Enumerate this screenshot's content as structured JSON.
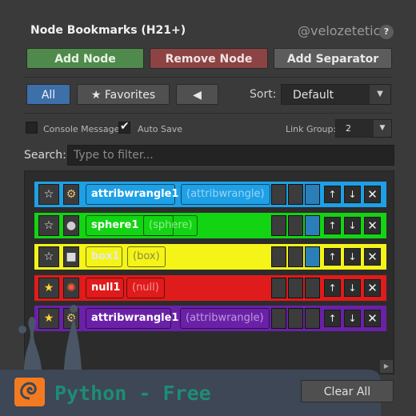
{
  "header": {
    "title": "Node Bookmarks (H21+)",
    "handle": "@velozetetic",
    "help": "?"
  },
  "toolbar": {
    "add": "Add Node",
    "remove": "Remove Node",
    "separator": "Add Separator"
  },
  "filters": {
    "all": "All",
    "favorites": "★ Favorites",
    "back": "◀",
    "sort_label": "Sort:",
    "sort_value": "Default"
  },
  "options": {
    "console": "Console Messages",
    "autosave": "Auto Save",
    "autosave_checked": true,
    "console_checked": false,
    "link_group_label": "Link Group:",
    "link_group_value": "2"
  },
  "search": {
    "label": "Search:",
    "placeholder": "Type to filter..."
  },
  "rows": [
    {
      "name": "attribwrangle1",
      "type": "(attribwrangle)",
      "color": "#1ea0e6",
      "favorite": false,
      "icon": "wrangle-icon",
      "slots": [
        false,
        false,
        true
      ]
    },
    {
      "name": "sphere1",
      "type": "(sphere)",
      "color": "#13d413",
      "favorite": false,
      "icon": "sphere-icon",
      "slots": [
        false,
        false,
        true
      ]
    },
    {
      "name": "box1",
      "type": "(box)",
      "color": "#f4f419",
      "favorite": false,
      "icon": "box-icon",
      "slots": [
        false,
        false,
        true
      ]
    },
    {
      "name": "null1",
      "type": "(null)",
      "color": "#e01b1b",
      "favorite": true,
      "icon": "null-icon",
      "slots": [
        false,
        false,
        false
      ]
    },
    {
      "name": "attribwrangle1",
      "type": "(attribwrangle)",
      "color": "#6a21a8",
      "favorite": true,
      "icon": "wrangle-icon",
      "slots": [
        false,
        false,
        false
      ]
    }
  ],
  "actions": {
    "up": "↑",
    "down": "↓",
    "remove": "✕"
  },
  "footer": {
    "logo_text": "Python - Free",
    "clear_all": "Clear All"
  }
}
